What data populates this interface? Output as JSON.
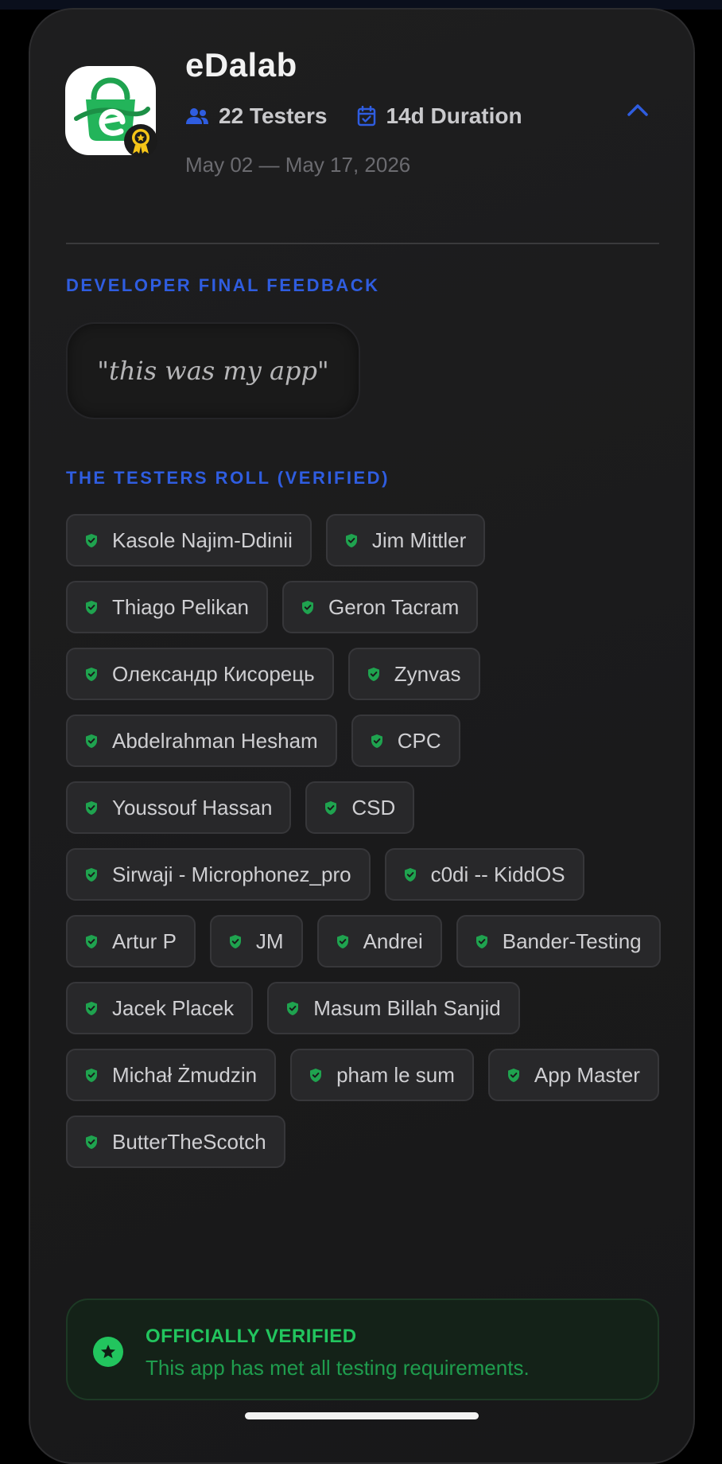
{
  "app": {
    "name": "eDalab",
    "testers_label": "22 Testers",
    "duration_label": "14d Duration",
    "dates": "May 02 — May 17, 2026"
  },
  "feedback": {
    "section_title": "DEVELOPER FINAL FEEDBACK",
    "quote": "\"this was my app\""
  },
  "testers": {
    "section_title": "THE TESTERS ROLL (VERIFIED)",
    "names": [
      "Kasole Najim-Ddinii",
      "Jim Mittler",
      "Thiago Pelikan",
      "Geron Tacram",
      "Олександр Кисорець",
      "Zynvas",
      "Abdelrahman Hesham",
      "CPC",
      "Youssouf Hassan",
      "CSD",
      "Sirwaji - Microphonez_pro",
      "c0di -- KiddOS",
      "Artur P",
      "JM",
      "Andrei",
      "Bander-Testing",
      "Jacek Placek",
      "Masum Billah Sanjid",
      "Michał Żmudzin",
      "pham le sum",
      "App Master",
      "ButterTheScotch"
    ]
  },
  "verified": {
    "title": "OFFICIALLY VERIFIED",
    "subtitle": "This app has met all testing requirements."
  },
  "icons": {
    "testers": "people-icon",
    "duration": "calendar-check-icon",
    "collapse": "chevron-up-icon",
    "chip": "shield-check-icon",
    "verified": "star-badge-icon",
    "badge": "award-medal-icon"
  },
  "colors": {
    "accent_blue": "#2f5de0",
    "verified_green": "#22c55e",
    "chip_check_green": "#1fa34f",
    "badge_gold": "#f5c518"
  }
}
